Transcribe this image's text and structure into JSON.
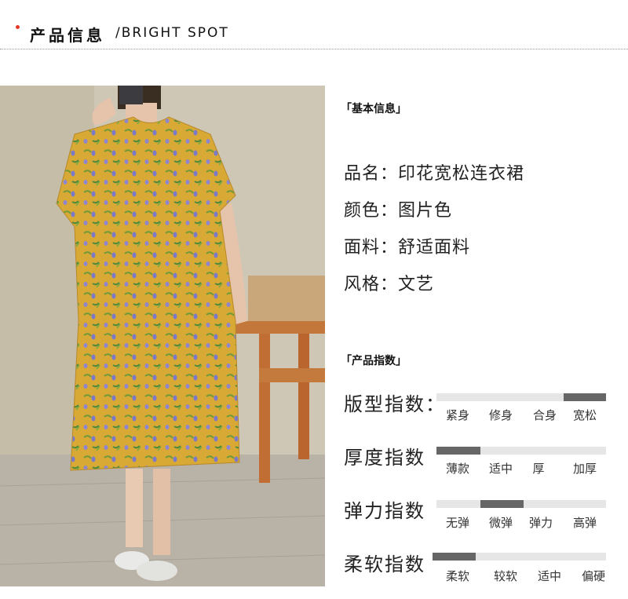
{
  "header": {
    "title_cn": "产品信息",
    "title_sep": "/",
    "title_en": "BRIGHT SPOT"
  },
  "basic": {
    "label": "「基本信息」",
    "rows": [
      {
        "text": "品名：印花宽松连衣裙"
      },
      {
        "text": "颜色：图片色"
      },
      {
        "text": "面料：舒适面料"
      },
      {
        "text": "风格：文艺"
      }
    ]
  },
  "indices": {
    "label": "「产品指数」",
    "items": [
      {
        "name": "版型指数：",
        "options": [
          "紧身",
          "修身",
          "合身",
          "宽松"
        ],
        "selected": "宽松"
      },
      {
        "name": "厚度指数",
        "options": [
          "薄款",
          "适中",
          "厚",
          "加厚"
        ],
        "selected": "薄款"
      },
      {
        "name": "弹力指数",
        "options": [
          "无弹",
          "微弹",
          "弹力",
          "高弹"
        ],
        "selected": "微弹"
      },
      {
        "name": "柔软指数",
        "options": [
          "柔软",
          "较软",
          "适中",
          "偏硬"
        ],
        "selected": "柔软"
      }
    ]
  },
  "colors": {
    "accent_dot": "#e63a28",
    "bar_fill": "#666666",
    "bar_track": "#e6e6e6",
    "dress": "#d9a93a"
  }
}
